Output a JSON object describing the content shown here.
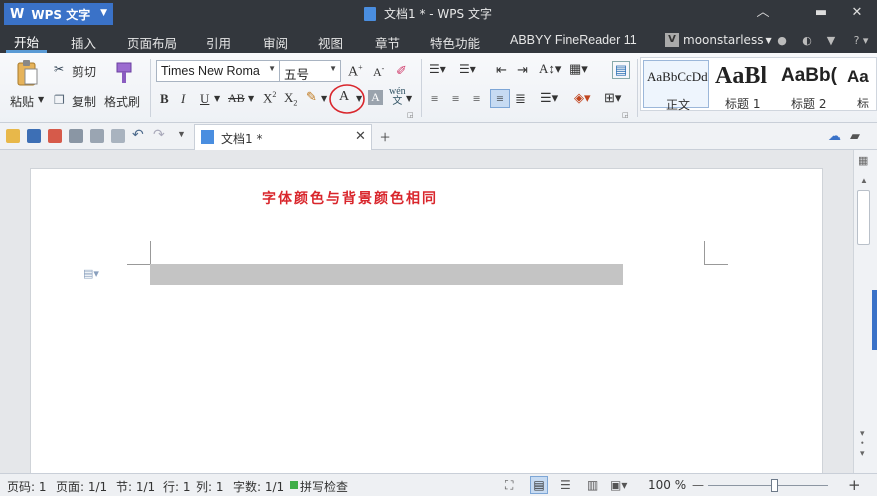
{
  "app": {
    "name": "WPS 文字",
    "logo_letter": "W"
  },
  "window": {
    "title": "文档1 * - WPS 文字"
  },
  "menu": {
    "tabs": [
      "开始",
      "插入",
      "页面布局",
      "引用",
      "审阅",
      "视图",
      "章节",
      "特色功能",
      "ABBYY FineReader 11"
    ],
    "user": "moonstarless",
    "user_initial": "V"
  },
  "ribbon": {
    "paste": "粘贴",
    "cut": "剪切",
    "copy": "复制",
    "format_painter": "格式刷",
    "font_name": "Times New Roma",
    "font_size": "五号",
    "styles": [
      {
        "preview": "AaBbCcDd",
        "label": "正文"
      },
      {
        "preview": "AaBl",
        "label": "标题 1"
      },
      {
        "preview": "AaBb(",
        "label": "标题 2"
      },
      {
        "preview": "Aa",
        "label": "标"
      }
    ]
  },
  "doc_tab": {
    "name": "文档1 *"
  },
  "document": {
    "annotation": "字体颜色与背景颜色相同"
  },
  "status": {
    "page": "页码: 1",
    "pages": "页面: 1/1",
    "section": "节: 1/1",
    "row": "行: 1",
    "col": "列: 1",
    "words": "字数: 1/1",
    "spellcheck": "拼写检查",
    "zoom": "100 %"
  },
  "colors": {
    "titlebar": "#33373d",
    "accent": "#3a72c8",
    "annotation_red": "#d9262c",
    "highlight_gray": "#c4c4c4"
  }
}
